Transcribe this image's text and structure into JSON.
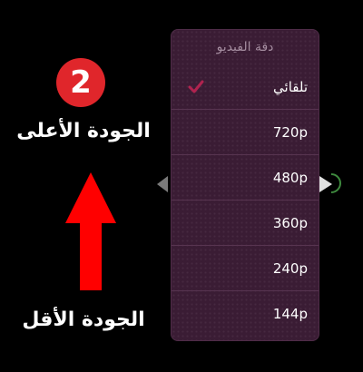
{
  "annotation": {
    "step_number": "2",
    "higher_quality_label": "الجودة الأعلى",
    "lower_quality_label": "الجودة الأقل",
    "arrow_color": "#ff0000",
    "badge_color": "#e0262b"
  },
  "quality_menu": {
    "title": "دقة الفيديو",
    "selected_index": 0,
    "accent_color": "#b0234f",
    "options": [
      {
        "label": "تلقائي",
        "selected": true
      },
      {
        "label": "720p",
        "selected": false
      },
      {
        "label": "480p",
        "selected": false
      },
      {
        "label": "360p",
        "selected": false
      },
      {
        "label": "240p",
        "selected": false
      },
      {
        "label": "144p",
        "selected": false
      }
    ]
  },
  "icons": {
    "check": "check-icon",
    "nav_left": "chevron-left-icon",
    "nav_right": "chevron-right-icon",
    "arrow": "arrow-up-icon"
  }
}
